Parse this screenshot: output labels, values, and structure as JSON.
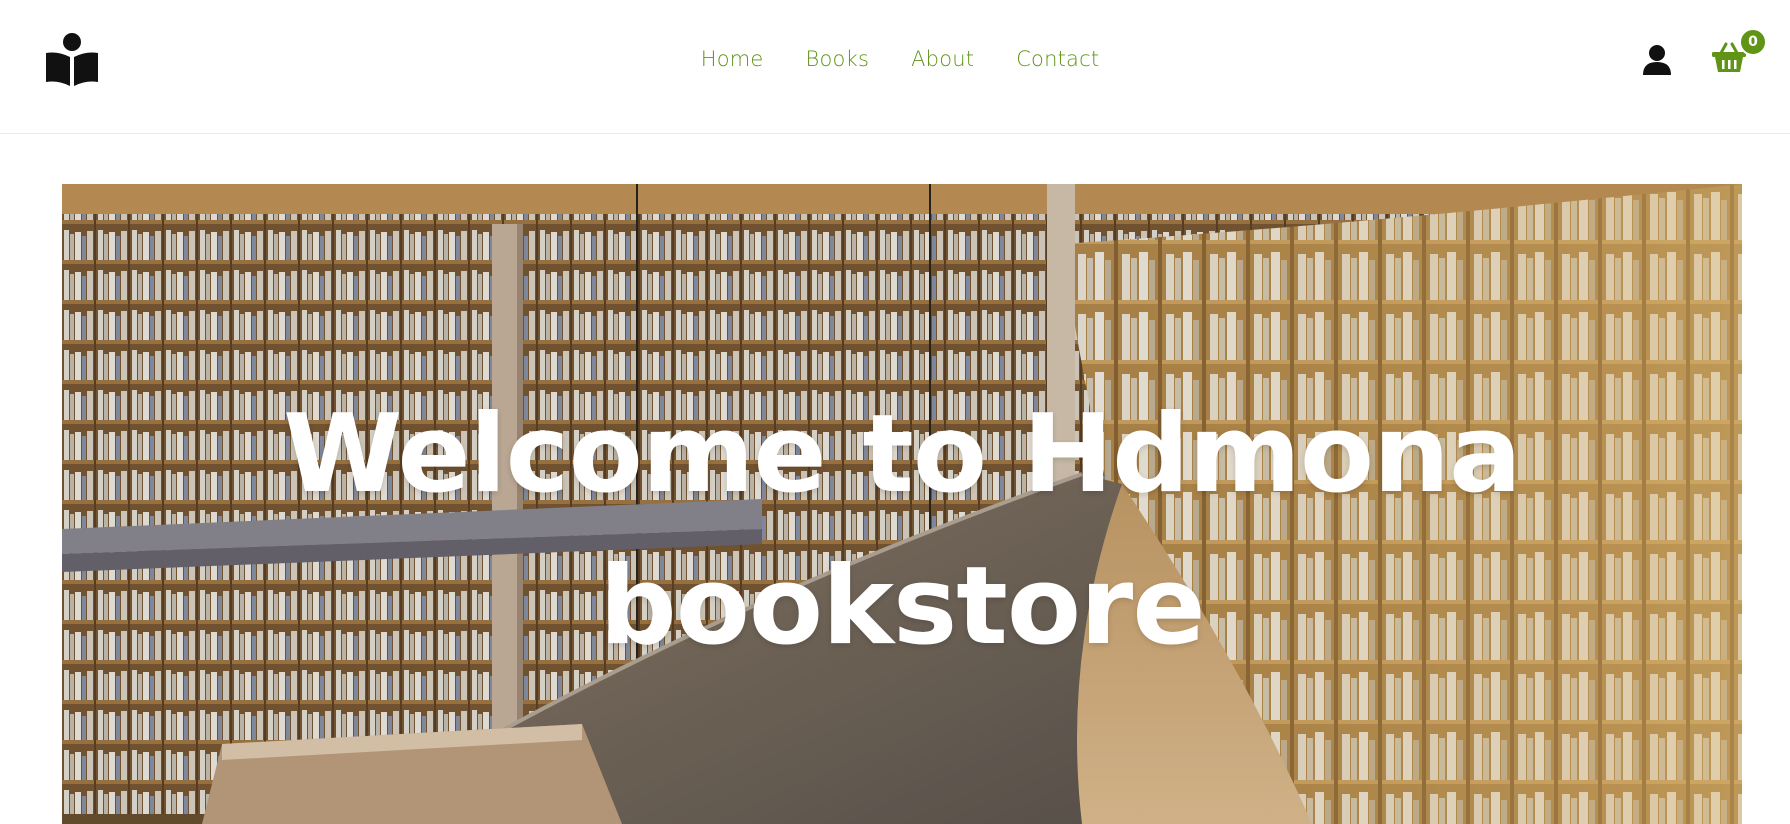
{
  "header": {
    "logo_icon": "book-reader-icon",
    "nav": [
      {
        "label": "Home"
      },
      {
        "label": "Books"
      },
      {
        "label": "About"
      },
      {
        "label": "Contact"
      }
    ],
    "user_icon": "user-icon",
    "cart_icon": "basket-icon",
    "cart_count": "0"
  },
  "hero": {
    "title_line1": "Welcome to Hdmona",
    "title_line2": "bookstore",
    "image": "library-bookshelves-photo"
  },
  "colors": {
    "accent": "#5f9416",
    "text_dark": "#111111",
    "hero_text": "#ffffff"
  }
}
